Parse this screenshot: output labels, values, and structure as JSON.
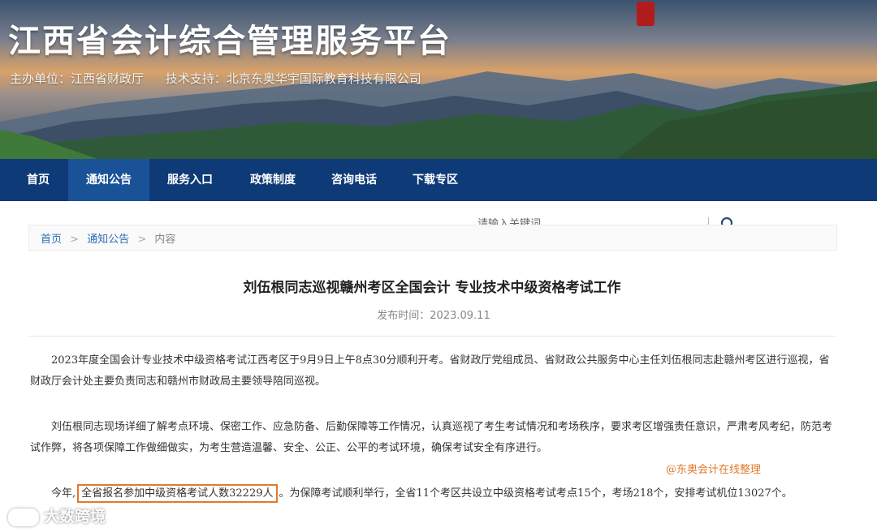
{
  "header": {
    "site_title": "江西省会计综合管理服务平台",
    "host": "主办单位：江西省财政厅",
    "tech_support": "技术支持：北京东奥华宇国际教育科技有限公司"
  },
  "nav": {
    "items": [
      {
        "label": "首页"
      },
      {
        "label": "通知公告"
      },
      {
        "label": "服务入口"
      },
      {
        "label": "政策制度"
      },
      {
        "label": "咨询电话"
      },
      {
        "label": "下载专区"
      }
    ],
    "active_index": 1
  },
  "breadcrumb": {
    "items": [
      "首页",
      "通知公告",
      "内容"
    ],
    "separator": ">"
  },
  "search": {
    "placeholder": "请输入关键词",
    "icon": "search-icon"
  },
  "article": {
    "title": "刘伍根同志巡视赣州考区全国会计 专业技术中级资格考试工作",
    "date_label": "发布时间：",
    "date": "2023.09.11",
    "paragraphs": {
      "p1": "2023年度全国会计专业技术中级资格考试江西考区于9月9日上午8点30分顺利开考。省财政厅党组成员、省财政公共服务中心主任刘伍根同志赴赣州考区进行巡视，省财政厅会计处主要负责同志和赣州市财政局主要领导陪同巡视。",
      "p2": "刘伍根同志现场详细了解考点环境、保密工作、应急防备、后勤保障等工作情况，认真巡视了考生考试情况和考场秩序，要求考区增强责任意识，严肃考风考纪，防范考试作弊，将各项保障工作做细做实，为考生营造温馨、安全、公正、公平的考试环境，确保考试安全有序进行。",
      "p3_before": "今年,",
      "p3_highlight": "全省报名参加中级资格考试人数32229人",
      "p3_after": "。为保障考试顺利举行，全省11个考区共设立中级资格考试考点15个，考场218个，安排考试机位13027个。"
    }
  },
  "watermarks": {
    "source": "@东奥会计在线整理",
    "logo_text": "大数跨境"
  },
  "colors": {
    "nav_bg": "#0f3a78",
    "nav_active": "#1a5298",
    "link": "#2c6fb6",
    "highlight_border": "#e07a2e"
  }
}
